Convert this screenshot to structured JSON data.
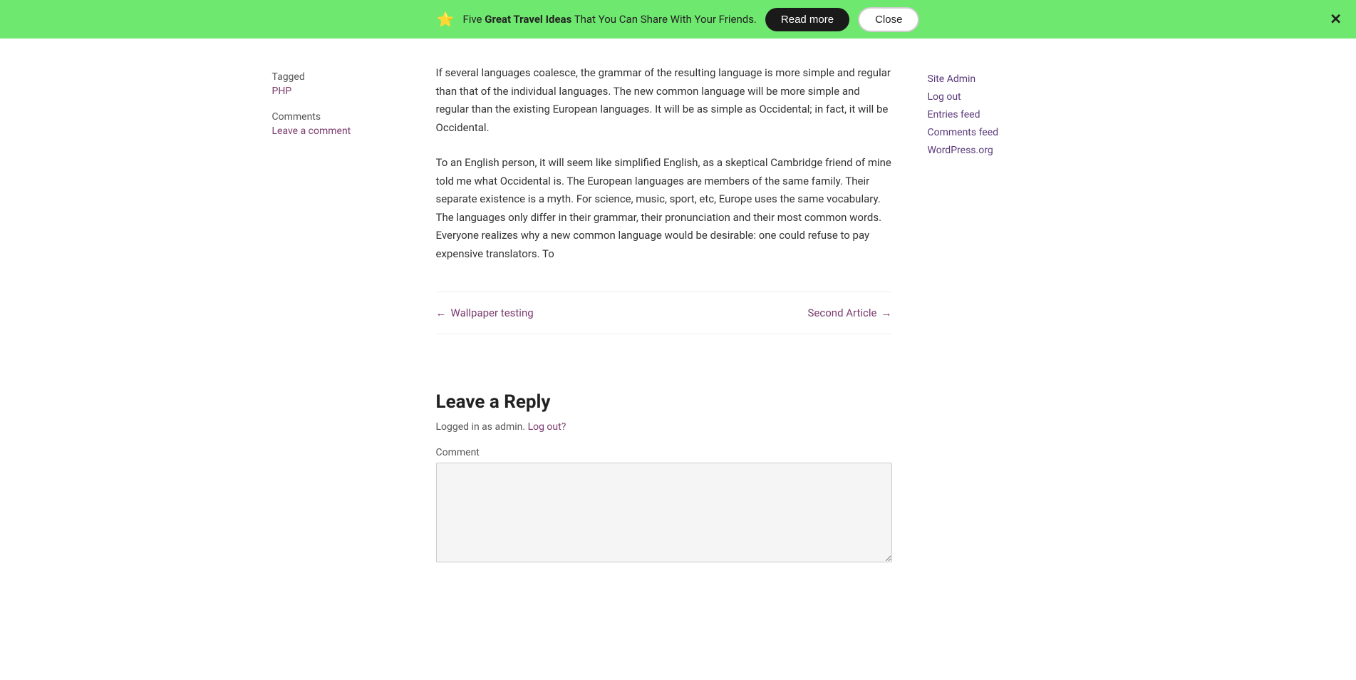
{
  "notification": {
    "star_icon": "⭐",
    "text_before": "Five ",
    "text_bold": "Great Travel Ideas",
    "text_after": " That You Can Share With Your Friends.",
    "read_more_label": "Read more",
    "close_label": "Close",
    "dismiss_icon": "✕"
  },
  "sidebar_left": {
    "tagged_label": "Tagged",
    "tagged_value": "PHP",
    "comments_label": "Comments",
    "leave_comment_label": "Leave a comment"
  },
  "article": {
    "paragraph1": "If several languages coalesce, the grammar of the resulting language is more simple and regular than that of the individual languages. The new common language will be more simple and regular than the existing European languages. It will be as simple as Occidental; in fact, it will be Occidental.",
    "paragraph2": "To an English person, it will seem like simplified English, as a skeptical Cambridge friend of mine told me what Occidental is. The European languages are members of the same family. Their separate existence is a myth. For science, music, sport, etc, Europe uses the same vocabulary. The languages only differ in their grammar, their pronunciation and their most common words. Everyone realizes why a new common language would be desirable: one could refuse to pay expensive translators. To"
  },
  "post_navigation": {
    "prev_arrow": "←",
    "prev_label": "Wallpaper testing",
    "next_label": "Second Article",
    "next_arrow": "→"
  },
  "leave_reply": {
    "title": "Leave a Reply",
    "logged_in_text": "Logged in as admin.",
    "logout_label": "Log out?",
    "comment_label": "Comment"
  },
  "sidebar_right": {
    "links": [
      {
        "label": "Site Admin",
        "href": "#"
      },
      {
        "label": "Log out",
        "href": "#"
      },
      {
        "label": "Entries feed",
        "href": "#"
      },
      {
        "label": "Comments feed",
        "href": "#"
      },
      {
        "label": "WordPress.org",
        "href": "#"
      }
    ]
  }
}
